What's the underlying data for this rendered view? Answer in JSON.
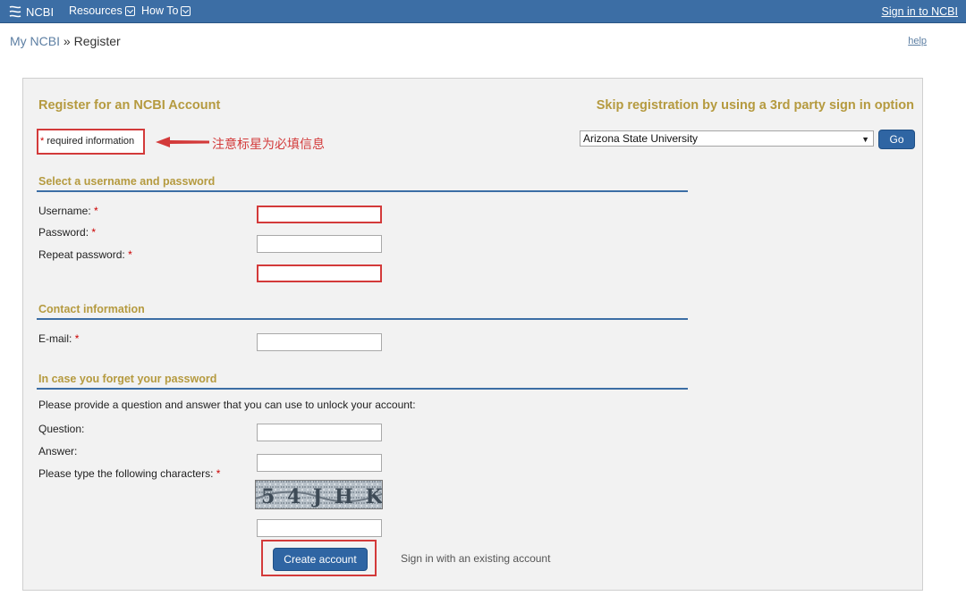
{
  "topbar": {
    "brand": "NCBI",
    "menus": [
      {
        "label": "Resources",
        "icon": "chevron-down-icon"
      },
      {
        "label": "How To",
        "icon": "chevron-down-icon"
      }
    ],
    "signin": "Sign in to NCBI"
  },
  "breadcrumb": {
    "parent": "My NCBI",
    "separator": " » ",
    "current": "Register"
  },
  "help": "help",
  "panel": {
    "title": "Register for an NCBI Account",
    "skip_title": "Skip registration by using a 3rd party sign in option",
    "required_star": "*",
    "required_text": " required information",
    "annotation": "注意标星为必填信息",
    "sso_selected": "Arizona State University",
    "go": "Go"
  },
  "sections": {
    "credentials": {
      "title": "Select a username and password",
      "username": "Username:",
      "password": "Password:",
      "repeat": "Repeat password:"
    },
    "contact": {
      "title": "Contact information",
      "email": "E-mail:"
    },
    "recovery": {
      "title": "In case you forget your password",
      "prompt": "Please provide a question and answer that you can use to unlock your account:",
      "question": "Question:",
      "answer": "Answer:",
      "captcha_label": "Please type the following characters:",
      "captcha_text": "5 4 J H K"
    }
  },
  "required_mark": "*",
  "actions": {
    "create": "Create account",
    "existing": "Sign in with an existing account"
  },
  "colors": {
    "topbar": "#3c6ea5",
    "heading": "#b59a3f",
    "button": "#2f65a3",
    "annotation_red": "#d33a3a"
  }
}
